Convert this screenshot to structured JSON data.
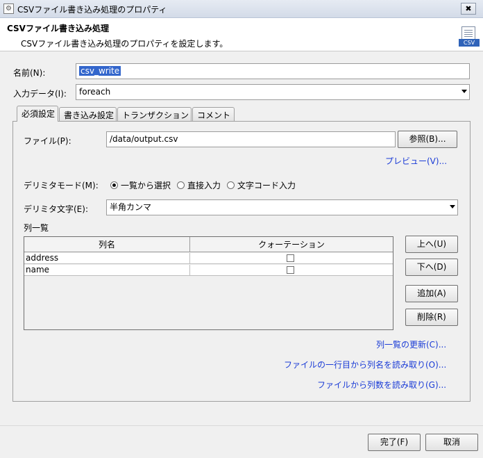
{
  "window": {
    "title": "CSVファイル書き込み処理のプロパティ",
    "close_glyph": "✖"
  },
  "header": {
    "title": "CSVファイル書き込み処理",
    "description": "CSVファイル書き込み処理のプロパティを設定します。",
    "icon_badge": "CSV",
    "icon_name": "csv-file-icon"
  },
  "form": {
    "name_label": "名前(N):",
    "name_value": "csv_write",
    "input_label": "入力データ(I):",
    "input_value": "foreach"
  },
  "tabs": [
    {
      "label": "必須設定",
      "active": true
    },
    {
      "label": "書き込み設定",
      "active": false
    },
    {
      "label": "トランザクション",
      "active": false
    },
    {
      "label": "コメント",
      "active": false
    }
  ],
  "required": {
    "file_label": "ファイル(P):",
    "file_value": "/data/output.csv",
    "browse_button": "参照(B)...",
    "preview_link": "プレビュー(V)...",
    "delimiter_mode_label": "デリミタモード(M):",
    "radio_options": [
      {
        "label": "一覧から選択",
        "selected": true
      },
      {
        "label": "直接入力",
        "selected": false
      },
      {
        "label": "文字コード入力",
        "selected": false
      }
    ],
    "delimiter_char_label": "デリミタ文字(E):",
    "delimiter_char_value": "半角カンマ",
    "columns_label": "列一覧",
    "table_headers": [
      "列名",
      "クォーテーション"
    ],
    "table_rows": [
      {
        "name": "address",
        "quoted": false
      },
      {
        "name": "name",
        "quoted": false
      }
    ],
    "up_button": "上へ(U)",
    "down_button": "下へ(D)",
    "add_button": "追加(A)",
    "delete_button": "削除(R)",
    "refresh_link": "列一覧の更新(C)...",
    "read_names_link": "ファイルの一行目から列名を読み取り(O)...",
    "read_count_link": "ファイルから列数を読み取り(G)..."
  },
  "footer": {
    "finish_button": "完了(F)",
    "cancel_button": "取消"
  },
  "colors": {
    "link": "#1a3bd6",
    "selection": "#3366cc",
    "csv_badge": "#2f63b9"
  }
}
